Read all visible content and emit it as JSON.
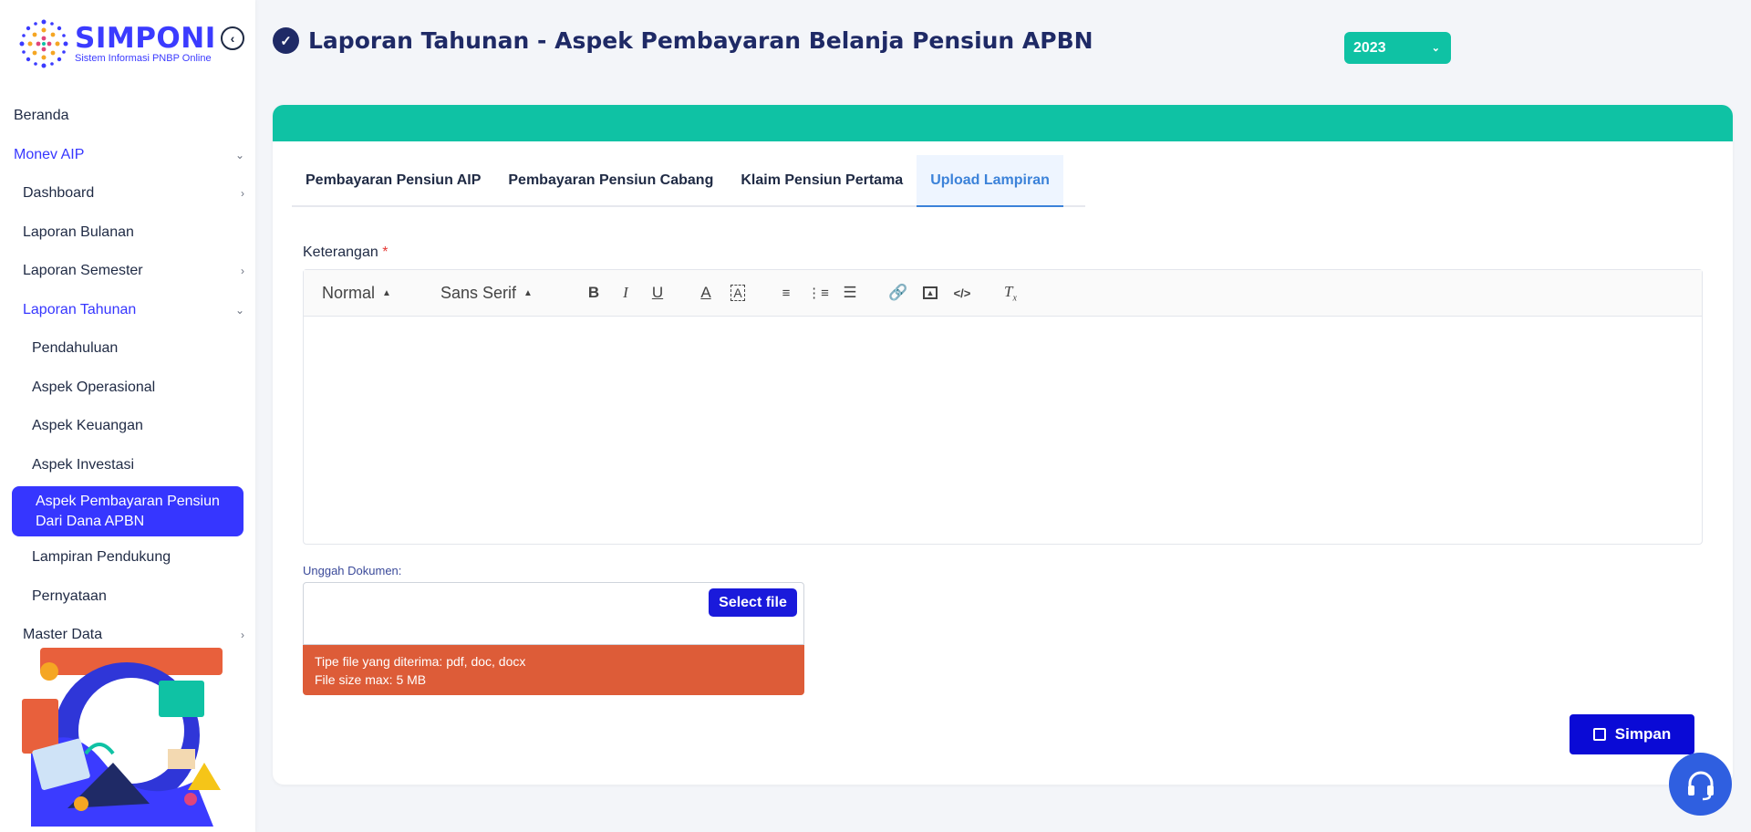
{
  "brand": {
    "name": "SIMPONI",
    "tagline": "Sistem Informasi PNBP Online"
  },
  "sidebar": {
    "items": [
      {
        "label": "Beranda"
      },
      {
        "label": "Monev AIP"
      },
      {
        "label": "Dashboard"
      },
      {
        "label": "Laporan Bulanan"
      },
      {
        "label": "Laporan Semester"
      },
      {
        "label": "Laporan Tahunan"
      },
      {
        "label": "Pendahuluan"
      },
      {
        "label": "Aspek Operasional"
      },
      {
        "label": "Aspek Keuangan"
      },
      {
        "label": "Aspek Investasi"
      },
      {
        "label": "Aspek Pembayaran Pensiun Dari Dana APBN"
      },
      {
        "label": "Lampiran Pendukung"
      },
      {
        "label": "Pernyataan"
      },
      {
        "label": "Master Data"
      }
    ]
  },
  "header": {
    "title": "Laporan Tahunan - Aspek Pembayaran Belanja Pensiun APBN",
    "year": "2023"
  },
  "tabs": [
    {
      "label": "Pembayaran Pensiun AIP"
    },
    {
      "label": "Pembayaran Pensiun Cabang"
    },
    {
      "label": "Klaim Pensiun Pertama"
    },
    {
      "label": "Upload Lampiran"
    }
  ],
  "form": {
    "keterangan_label": "Keterangan",
    "required_mark": "*",
    "editor": {
      "format": "Normal",
      "font": "Sans Serif"
    },
    "upload_label": "Unggah Dokumen:",
    "select_file": "Select file",
    "accepted_types": "Tipe file yang diterima: pdf, doc, docx",
    "max_size": "File size max: 5 MB",
    "save": "Simpan"
  },
  "colors": {
    "primary": "#3636ff",
    "accent": "#0fc2a4",
    "warning": "#dd5c38",
    "button": "#0a0ad6"
  }
}
